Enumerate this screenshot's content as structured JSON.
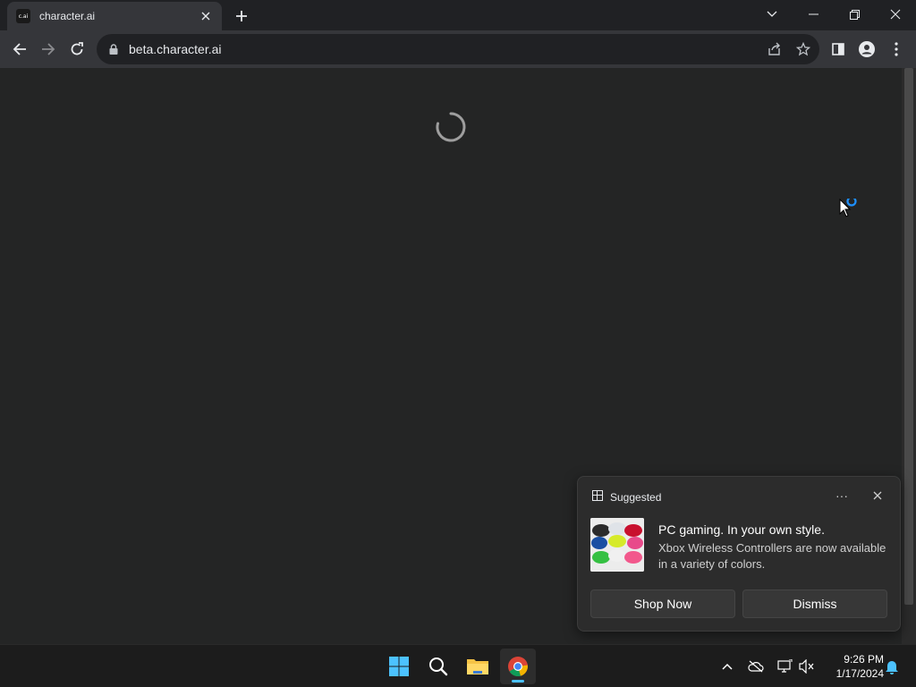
{
  "browser": {
    "tab": {
      "favicon_text": "c.ai",
      "title": "character.ai"
    },
    "url": "beta.character.ai"
  },
  "notification": {
    "header": "Suggested",
    "more": "···",
    "headline": "PC gaming. In your own style.",
    "body": "Xbox Wireless Controllers are now available in a variety of colors.",
    "primary_button": "Shop Now",
    "secondary_button": "Dismiss"
  },
  "taskbar": {
    "time": "9:26 PM",
    "date": "1/17/2024"
  },
  "colors": {
    "content_bg": "#242525",
    "accent": "#4cc2ff",
    "toolbar": "#35363a"
  }
}
